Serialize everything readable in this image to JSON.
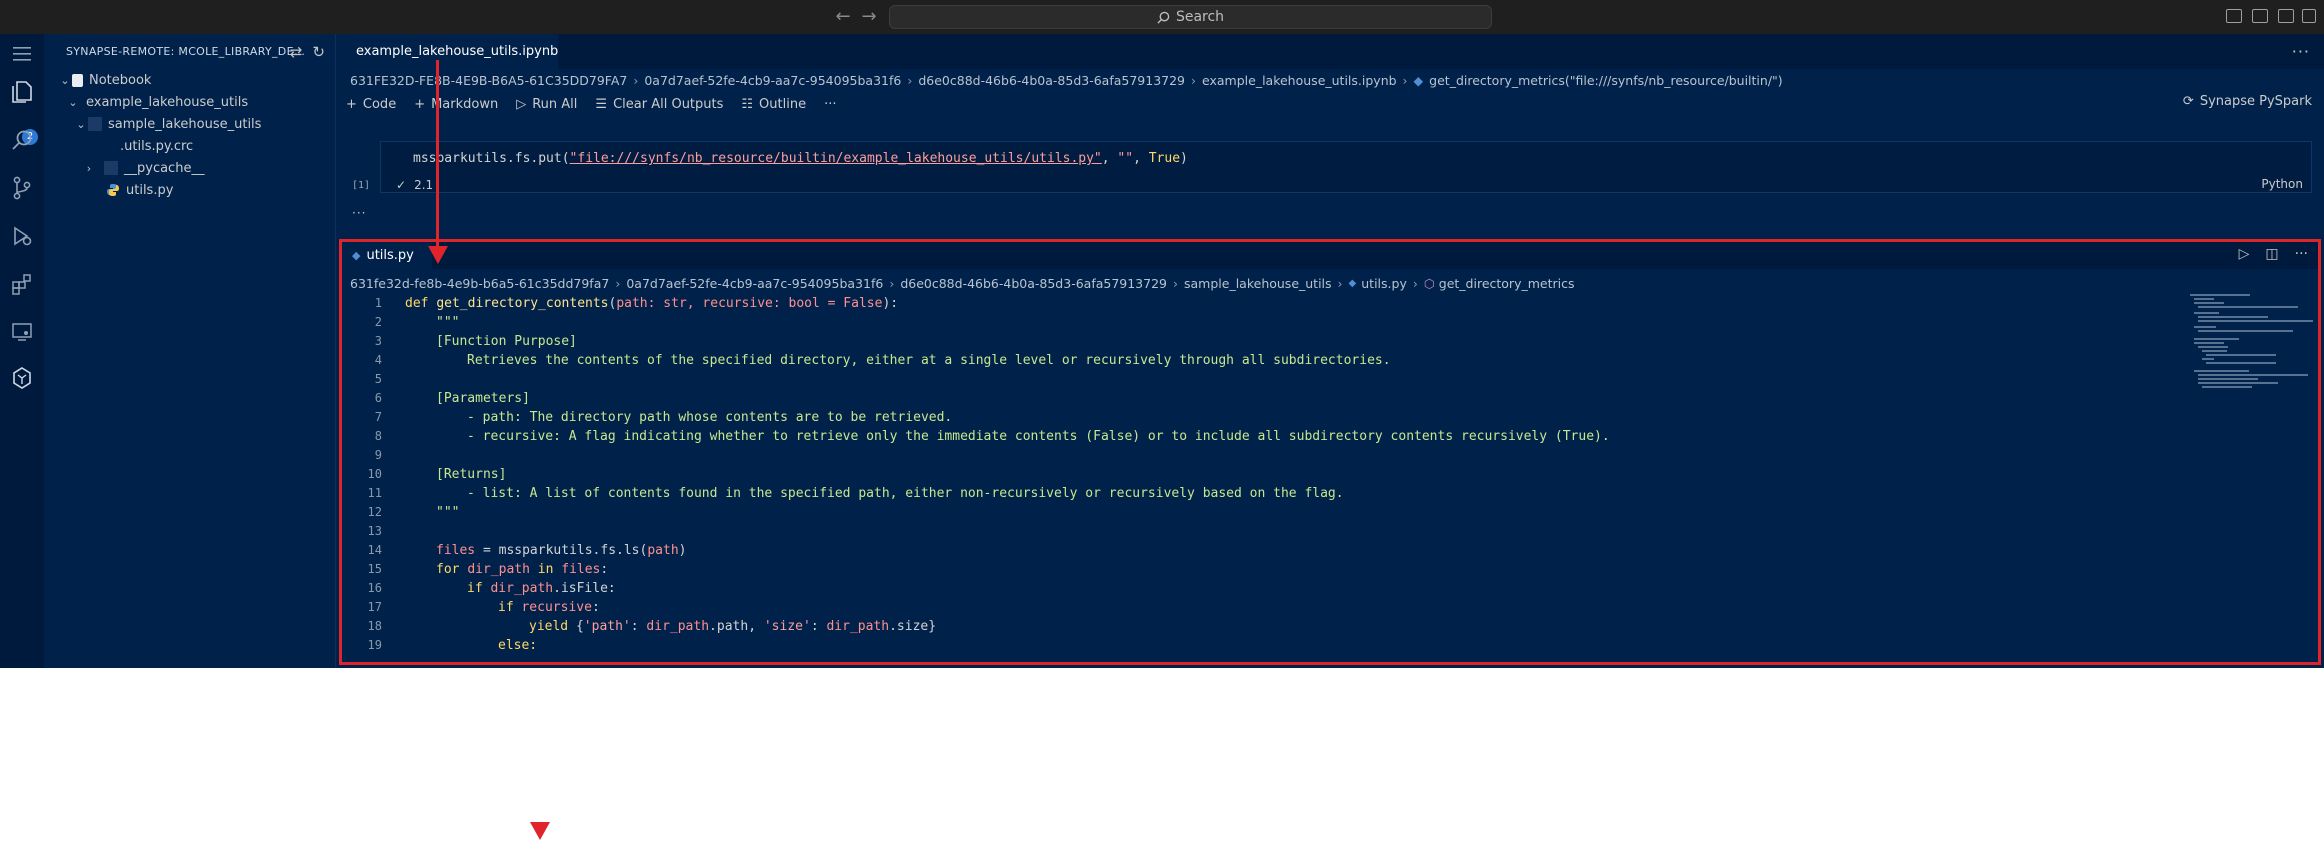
{
  "titlebar": {
    "search_placeholder": "Search"
  },
  "activity": {
    "explorer_badge": "2"
  },
  "sidebar": {
    "header": "SYNAPSE-REMOTE: MCOLE_LIBRARY_DE...",
    "items": [
      {
        "label": "Notebook"
      },
      {
        "label": "example_lakehouse_utils"
      },
      {
        "label": "sample_lakehouse_utils"
      },
      {
        "label": ".utils.py.crc"
      },
      {
        "label": "__pycache__"
      },
      {
        "label": "utils.py"
      }
    ]
  },
  "editor": {
    "tab_label": "example_lakehouse_utils.ipynb",
    "breadcrumb": [
      "631FE32D-FE8B-4E9B-B6A5-61C35DD79FA7",
      "0a7d7aef-52fe-4cb9-aa7c-954095ba31f6",
      "d6e0c88d-46b6-4b0a-85d3-6afa57913729",
      "example_lakehouse_utils.ipynb",
      "get_directory_metrics(\"file:///synfs/nb_resource/builtin/\")"
    ],
    "toolbar": {
      "code": "Code",
      "markdown": "Markdown",
      "run_all": "Run All",
      "clear_outputs": "Clear All Outputs",
      "outline": "Outline"
    },
    "kernel": "Synapse PySpark",
    "cell": {
      "code_prefix": "mssparkutils.fs.put(",
      "code_path": "\"file:///synfs/nb_resource/builtin/example_lakehouse_utils/utils.py\"",
      "code_suffix_str": "\"\"",
      "code_suffix_bool": "True",
      "language": "Python",
      "exec_count": "[1]",
      "exec_time": "2.1"
    }
  },
  "file_editor": {
    "tab_label": "utils.py",
    "breadcrumb": [
      "631fe32d-fe8b-4e9b-b6a5-61c35dd79fa7",
      "0a7d7aef-52fe-4cb9-aa7c-954095ba31f6",
      "d6e0c88d-46b6-4b0a-85d3-6afa57913729",
      "sample_lakehouse_utils",
      "utils.py",
      "get_directory_metrics"
    ],
    "lines": {
      "l1_fn": "get_directory_contents",
      "l1_params": "path: str, recursive: bool = False",
      "l2": "\"\"\"",
      "l3": "[Function Purpose]",
      "l4": "Retrieves the contents of the specified directory, either at a single level or recursively through all subdirectories.",
      "l6": "[Parameters]",
      "l7": "- path: The directory path whose contents are to be retrieved.",
      "l8": "- recursive: A flag indicating whether to retrieve only the immediate contents (False) or to include all subdirectory contents recursively (True).",
      "l10": "[Returns]",
      "l11": "- list: A list of contents found in the specified path, either non-recursively or recursively based on the flag.",
      "l12": "\"\"\"",
      "l14_var": "files",
      "l14_call": "mssparkutils.fs.ls",
      "l14_arg": "path",
      "l15": "dir_path",
      "l15_iter": "files",
      "l16": "dir_path",
      "l16_attr": "isFile",
      "l17": "recursive",
      "l18_key1": "'path'",
      "l18_val1": "dir_path",
      "l18_attr1": "path",
      "l18_key2": "'size'",
      "l18_val2": "dir_path",
      "l18_attr2": "size"
    }
  }
}
